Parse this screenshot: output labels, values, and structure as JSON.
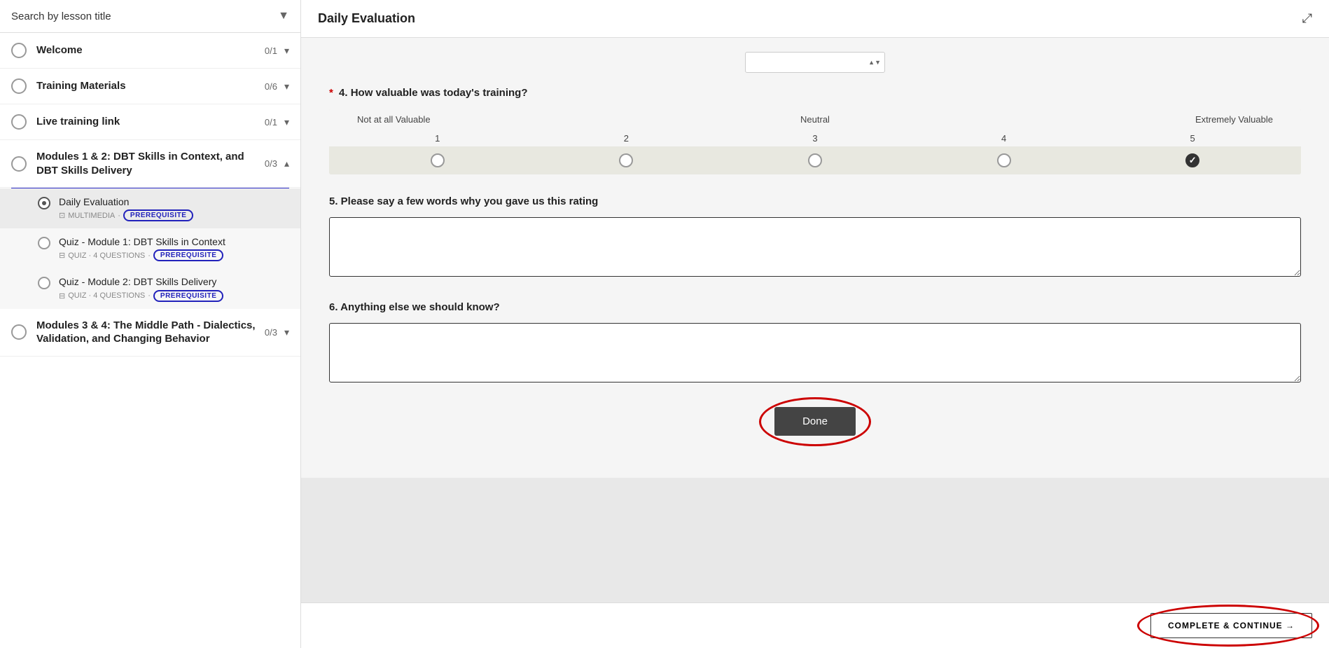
{
  "sidebar": {
    "search_placeholder": "Search by lesson title",
    "items": [
      {
        "id": "welcome",
        "label": "Welcome",
        "count": "0/1",
        "expanded": false,
        "circle": "empty"
      },
      {
        "id": "training-materials",
        "label": "Training Materials",
        "count": "0/6",
        "expanded": false,
        "circle": "empty"
      },
      {
        "id": "live-training",
        "label": "Live training link",
        "count": "0/1",
        "expanded": false,
        "circle": "empty"
      },
      {
        "id": "modules-1-2",
        "label": "Modules 1 & 2: DBT Skills in Context, and DBT Skills Delivery",
        "count": "0/3",
        "expanded": true,
        "circle": "empty"
      }
    ],
    "sub_items": [
      {
        "id": "daily-eval",
        "label": "Daily Evaluation",
        "meta_icon": "multimedia",
        "meta_text": "MULTIMEDIA",
        "prerequisite": true,
        "active": true
      },
      {
        "id": "quiz-module-1",
        "label": "Quiz - Module 1: DBT Skills in Context",
        "meta_icon": "quiz",
        "meta_text": "QUIZ · 4 QUESTIONS",
        "prerequisite": true,
        "active": false
      },
      {
        "id": "quiz-module-2",
        "label": "Quiz - Module 2: DBT Skills Delivery",
        "meta_icon": "quiz",
        "meta_text": "QUIZ · 4 QUESTIONS",
        "prerequisite": true,
        "active": false
      }
    ],
    "modules_3_4": {
      "label": "Modules 3 & 4: The Middle Path - Dialectics, Validation, and Changing Behavior",
      "count": "0/3",
      "circle": "empty"
    }
  },
  "main": {
    "title": "Daily Evaluation",
    "expand_icon": "⤢",
    "question4": {
      "number": "4",
      "required": true,
      "text": "How valuable was today's training?",
      "scale": {
        "min_label": "Not at all Valuable",
        "mid_label": "Neutral",
        "max_label": "Extremely Valuable",
        "min_num": "1",
        "nums": [
          "1",
          "2",
          "3",
          "4",
          "5"
        ],
        "labels": [
          "Not at all Valuable",
          "",
          "Neutral",
          "",
          "Extremely Valuable"
        ],
        "selected": 5
      }
    },
    "question5": {
      "number": "5",
      "required": false,
      "text": "Please say a few words why you gave us this rating",
      "value": ""
    },
    "question6": {
      "number": "6",
      "required": false,
      "text": "Anything else we should know?",
      "value": ""
    },
    "done_button_label": "Done",
    "complete_button_label": "COMPLETE & CONTINUE →"
  }
}
